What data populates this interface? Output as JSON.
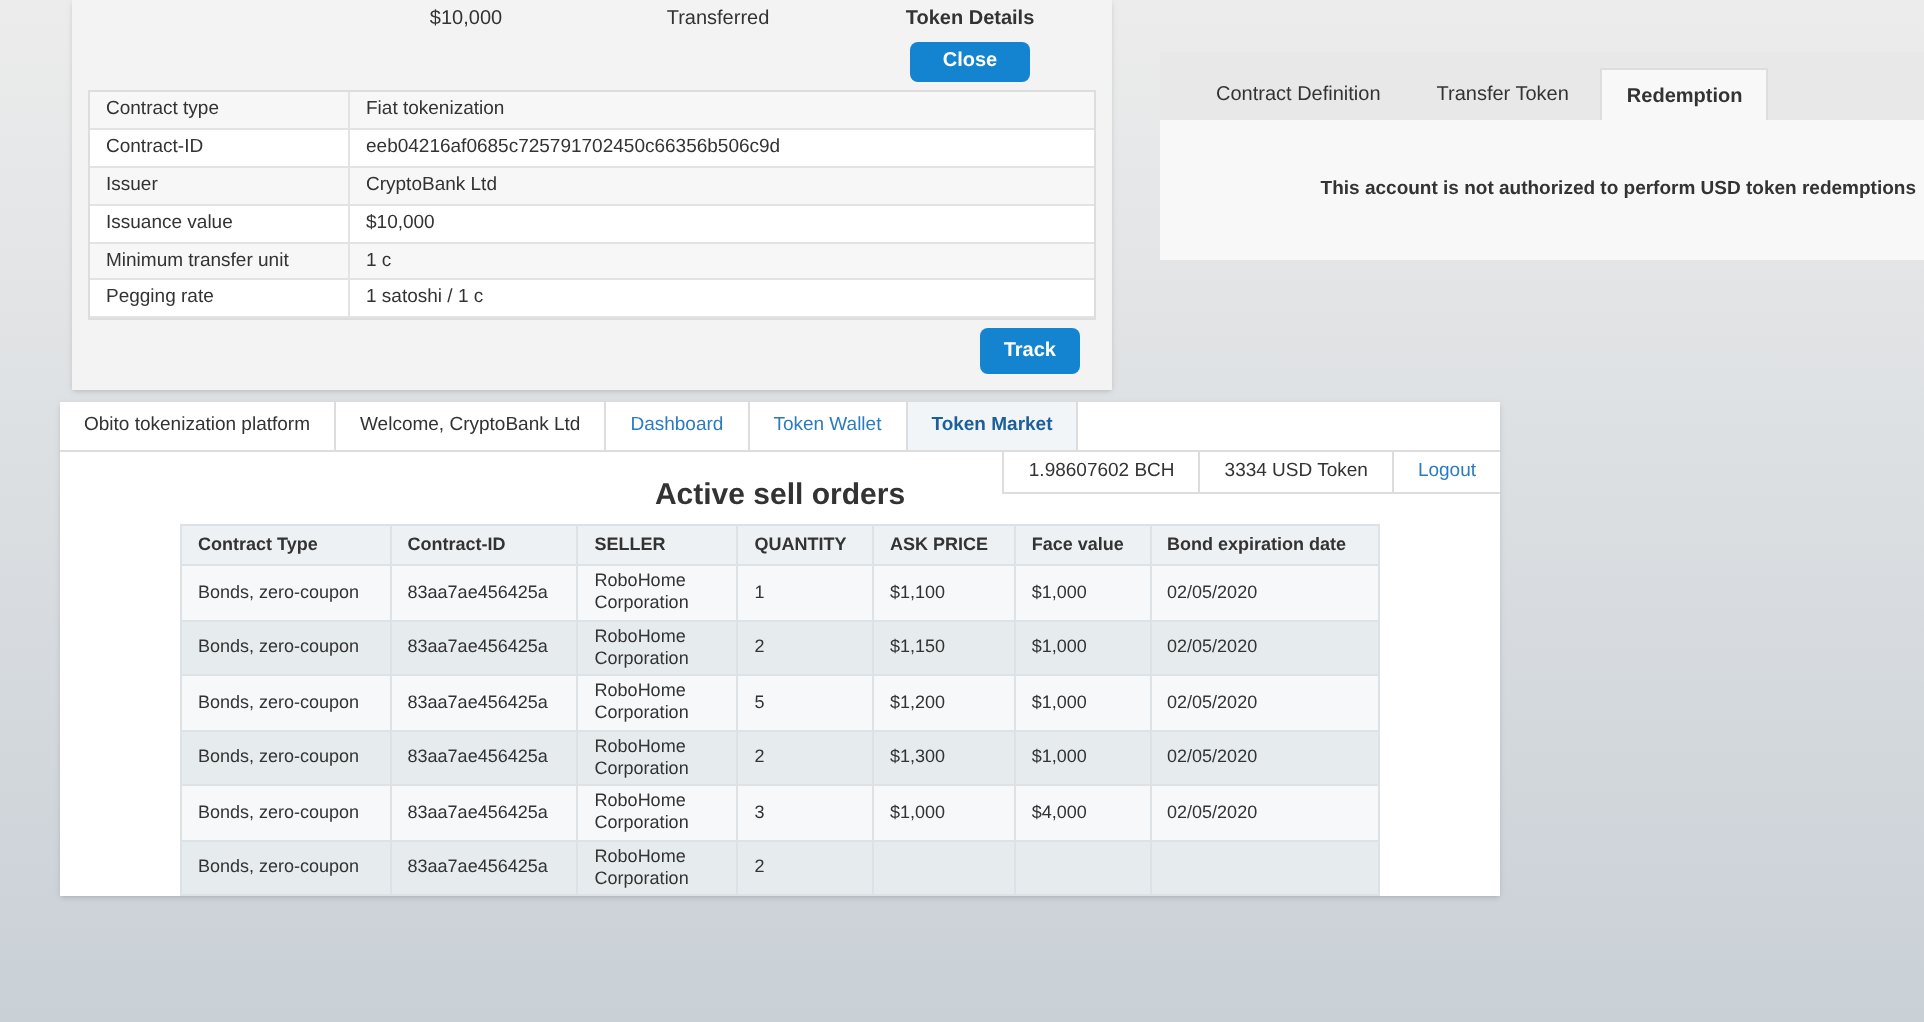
{
  "token_details": {
    "header_cells": [
      "$10,000",
      "Transferred"
    ],
    "header_title": "Token Details",
    "close_button": "Close",
    "rows": [
      {
        "label": "Contract type",
        "value": "Fiat tokenization"
      },
      {
        "label": "Contract-ID",
        "value": "eeb04216af0685c725791702450c66356b506c9d"
      },
      {
        "label": "Issuer",
        "value": "CryptoBank Ltd"
      },
      {
        "label": "Issuance value",
        "value": "$10,000"
      },
      {
        "label": "Minimum transfer unit",
        "value": "1 c"
      },
      {
        "label": "Pegging rate",
        "value": "1 satoshi / 1 c"
      }
    ],
    "track_button": "Track"
  },
  "contract_panel": {
    "tabs": [
      {
        "label": "Contract Definition",
        "selected": false
      },
      {
        "label": "Transfer Token",
        "selected": false
      },
      {
        "label": "Redemption",
        "selected": true
      }
    ],
    "message": "This account is not authorized to perform USD token redemptions"
  },
  "nav": {
    "items": [
      {
        "label": "Obito tokenization platform",
        "kind": "text"
      },
      {
        "label": "Welcome, CryptoBank Ltd",
        "kind": "text"
      },
      {
        "label": "Dashboard",
        "kind": "link",
        "selected": false
      },
      {
        "label": "Token Wallet",
        "kind": "link",
        "selected": false
      },
      {
        "label": "Token Market",
        "kind": "link",
        "selected": true
      }
    ]
  },
  "account": {
    "bch": "1.98607602 BCH",
    "usd": "3334 USD Token",
    "logout": "Logout"
  },
  "sell_orders": {
    "title": "Active sell orders",
    "columns": [
      "Contract Type",
      "Contract-ID",
      "SELLER",
      "QUANTITY",
      "ASK PRICE",
      "Face value",
      "Bond expiration date"
    ],
    "rows": [
      [
        "Bonds, zero-coupon",
        "83aa7ae456425a",
        "RoboHome Corporation",
        "1",
        "$1,100",
        "$1,000",
        "02/05/2020"
      ],
      [
        "Bonds, zero-coupon",
        "83aa7ae456425a",
        "RoboHome Corporation",
        "2",
        "$1,150",
        "$1,000",
        "02/05/2020"
      ],
      [
        "Bonds, zero-coupon",
        "83aa7ae456425a",
        "RoboHome Corporation",
        "5",
        "$1,200",
        "$1,000",
        "02/05/2020"
      ],
      [
        "Bonds, zero-coupon",
        "83aa7ae456425a",
        "RoboHome Corporation",
        "2",
        "$1,300",
        "$1,000",
        "02/05/2020"
      ],
      [
        "Bonds, zero-coupon",
        "83aa7ae456425a",
        "RoboHome Corporation",
        "3",
        "$1,000",
        "$4,000",
        "02/05/2020"
      ],
      [
        "Bonds, zero-coupon",
        "83aa7ae456425a",
        "RoboHome Corporation",
        "2"
      ]
    ]
  }
}
